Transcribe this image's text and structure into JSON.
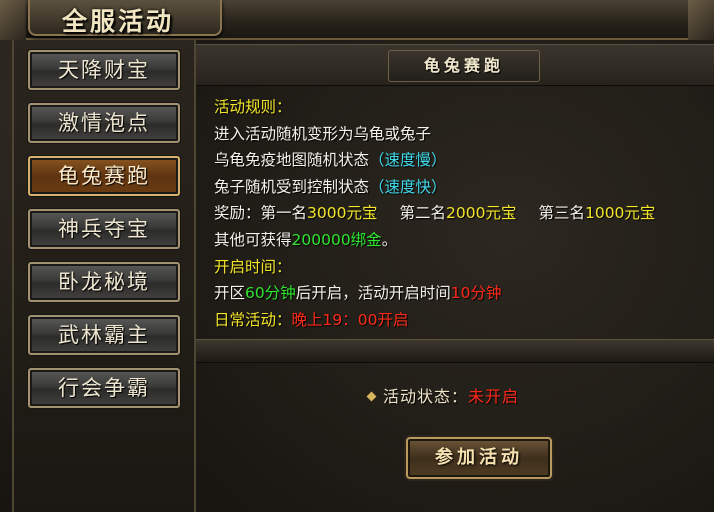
{
  "window": {
    "title": "全服活动"
  },
  "sidebar": {
    "items": [
      {
        "label": "天降财宝",
        "active": false
      },
      {
        "label": "激情泡点",
        "active": false
      },
      {
        "label": "龟兔赛跑",
        "active": true
      },
      {
        "label": "神兵夺宝",
        "active": false
      },
      {
        "label": "卧龙秘境",
        "active": false
      },
      {
        "label": "武林霸主",
        "active": false
      },
      {
        "label": "行会争霸",
        "active": false
      }
    ]
  },
  "panel": {
    "title": "龟兔赛跑",
    "rules_heading": "活动规则：",
    "line1": "进入活动随机变形为乌龟或兔子",
    "line2_text": "乌龟免疫地图随机状态",
    "line2_note": "（速度慢）",
    "line3_text": "兔子随机受到控制状态",
    "line3_note": "（速度快）",
    "reward_label": "奖励：",
    "reward1_label": "第一名",
    "reward1_value": "3000元宝",
    "reward2_label": "第二名",
    "reward2_value": "2000元宝",
    "reward3_label": "第三名",
    "reward3_value": "1000元宝",
    "other_text": "其他可获得",
    "other_value": "200000绑金",
    "other_end": "。",
    "open_heading": "开启时间：",
    "open_prefix": "开区",
    "open_value1": "60分钟",
    "open_mid": "后开启，活动开启时间",
    "open_value2": "10分钟",
    "daily_label": "日常活动：",
    "daily_value": "晚上19：00开启",
    "status_label": "活动状态：",
    "status_value": "未开启",
    "join_button": "参加活动"
  },
  "colors": {
    "highlight_yellow": "#f2e52a",
    "note_cyan": "#3fd6e8",
    "reward_green": "#2ee52e",
    "alert_red": "#ff2a1a",
    "active_tab": "#8a5520"
  },
  "icons": [
    "diamond-icon"
  ]
}
